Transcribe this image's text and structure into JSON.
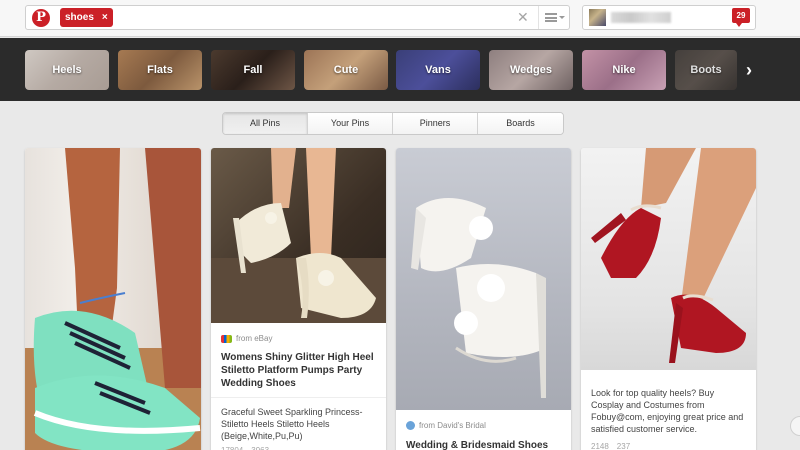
{
  "search": {
    "token": "shoes",
    "token_close": "×",
    "clear": "✕"
  },
  "user": {
    "notifications": "29"
  },
  "guides": [
    {
      "label": "Heels",
      "bg": "linear-gradient(135deg,#cfc8c2,#b5aaa3 50%,#a89c94)"
    },
    {
      "label": "Flats",
      "bg": "linear-gradient(135deg,#a67a52,#7d5a3e 50%,#b9936a)"
    },
    {
      "label": "Fall",
      "bg": "linear-gradient(135deg,#4b3a2e,#2a1f1a 50%,#6e5646)"
    },
    {
      "label": "Cute",
      "bg": "linear-gradient(135deg,#9c7456,#c4a07a 50%,#7a5a44)"
    },
    {
      "label": "Vans",
      "bg": "linear-gradient(135deg,#3a3f78,#4c4f9a 50%,#2c2f5e)"
    },
    {
      "label": "Wedges",
      "bg": "linear-gradient(135deg,#8e7f7f,#b6a6a3 50%,#6f6262)"
    },
    {
      "label": "Nike",
      "bg": "linear-gradient(135deg,#c392a6,#9b6f88 50%,#c8a0b4)"
    },
    {
      "label": "Boots",
      "bg": "linear-gradient(135deg,#4a4440,#5f5650 50%,#3a3532)"
    }
  ],
  "guide_next": "›",
  "tabs": [
    "All Pins",
    "Your Pins",
    "Pinners",
    "Boards"
  ],
  "pins": [
    {
      "image_desc": "mint green sneakers"
    },
    {
      "source": "from eBay",
      "title": "Womens Shiny Glitter High Heel Stiletto Platform Pumps Party Wedding Shoes",
      "desc": "Graceful Sweet Sparkling Princess-Stiletto Heels Stiletto Heels (Beige,White,Pu,Pu)",
      "repins": "17804",
      "likes": "3963"
    },
    {
      "source": "from David's Bridal",
      "title": "Wedding & Bridesmaid Shoes"
    },
    {
      "desc": "Look for top quality heels? Buy Cosplay and Costumes from Fobuy@com, enjoying great price and satisfied customer service.",
      "repins": "2148",
      "likes": "237"
    }
  ],
  "colors": {
    "brand_red": "#cb2027",
    "guide_bar": "#2b2b2b"
  }
}
